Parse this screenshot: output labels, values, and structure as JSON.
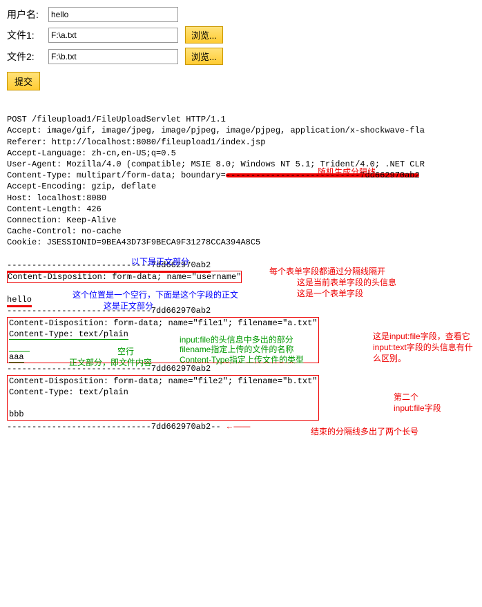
{
  "form": {
    "username_label": "用户名:",
    "file1_label": "文件1:",
    "file2_label": "文件2:",
    "username_value": "hello",
    "file1_value": "F:\\a.txt",
    "file2_value": "F:\\b.txt",
    "browse_label": "浏览...",
    "submit_label": "提交"
  },
  "http": {
    "line1": "POST /fileupload1/FileUploadServlet HTTP/1.1",
    "line2": "Accept: image/gif, image/jpeg, image/pjpeg, image/pjpeg, application/x-shockwave-fla",
    "line3": "Referer: http://localhost:8080/fileupload1/index.jsp",
    "line4": "Accept-Language: zh-cn,en-US;q=0.5",
    "line5": "User-Agent: Mozilla/4.0 (compatible; MSIE 8.0; Windows NT 5.1; Trident/4.0; .NET CLR",
    "line6a": "Content-Type: multipart/form-data; boundary=",
    "line6b": "---------------------------7dd662970ab2",
    "line7": "Accept-Encoding: gzip, deflate",
    "line8": "Host: localhost:8080",
    "line9": "Content-Length: 426",
    "line10": "Connection: Keep-Alive",
    "line11": "Cache-Control: no-cache",
    "line12": "Cookie: JSESSIONID=9BEA43D73F9BECA9F31278CCA394A8C5",
    "line13": "",
    "boundary_open": "-----------------------------7dd662970ab2",
    "cd_username": "Content-Disposition: form-data; name=\"username\"",
    "body_username": "hello",
    "cd_file1": "Content-Disposition: form-data; name=\"file1\"; filename=\"a.txt\"",
    "ct_plain": "Content-Type: text/plain",
    "body_file1": "aaa",
    "cd_file2": "Content-Disposition: form-data; name=\"file2\"; filename=\"b.txt\"",
    "body_file2": "bbb",
    "boundary_close": "-----------------------------7dd662970ab2--"
  },
  "anno": {
    "random_boundary": "随机生成分隔线",
    "below_body": "以下是正文部分",
    "each_field_sep": "每个表单字段都通过分隔线隔开",
    "field_header": "这是当前表单字段的头信息",
    "is_form_field": "这是一个表单字段",
    "blank_then_body": "这个位置是一个空行，下面是这个字段的正文",
    "is_body": "这是正文部分",
    "file_extra_header": "input:file的头信息中多出的部分\nfilename指定上传的文件的名称\nContent-Type指定上传文件的类型",
    "blank_line": "空行",
    "body_is_content": "正文部分，即文件内容",
    "is_file_field": "这是input:file字段，查看它input:text字段的头信息有什么区别。",
    "second_file": "第二个\ninput:file字段",
    "final_extra_dash": "结束的分隔线多出了两个长号"
  }
}
